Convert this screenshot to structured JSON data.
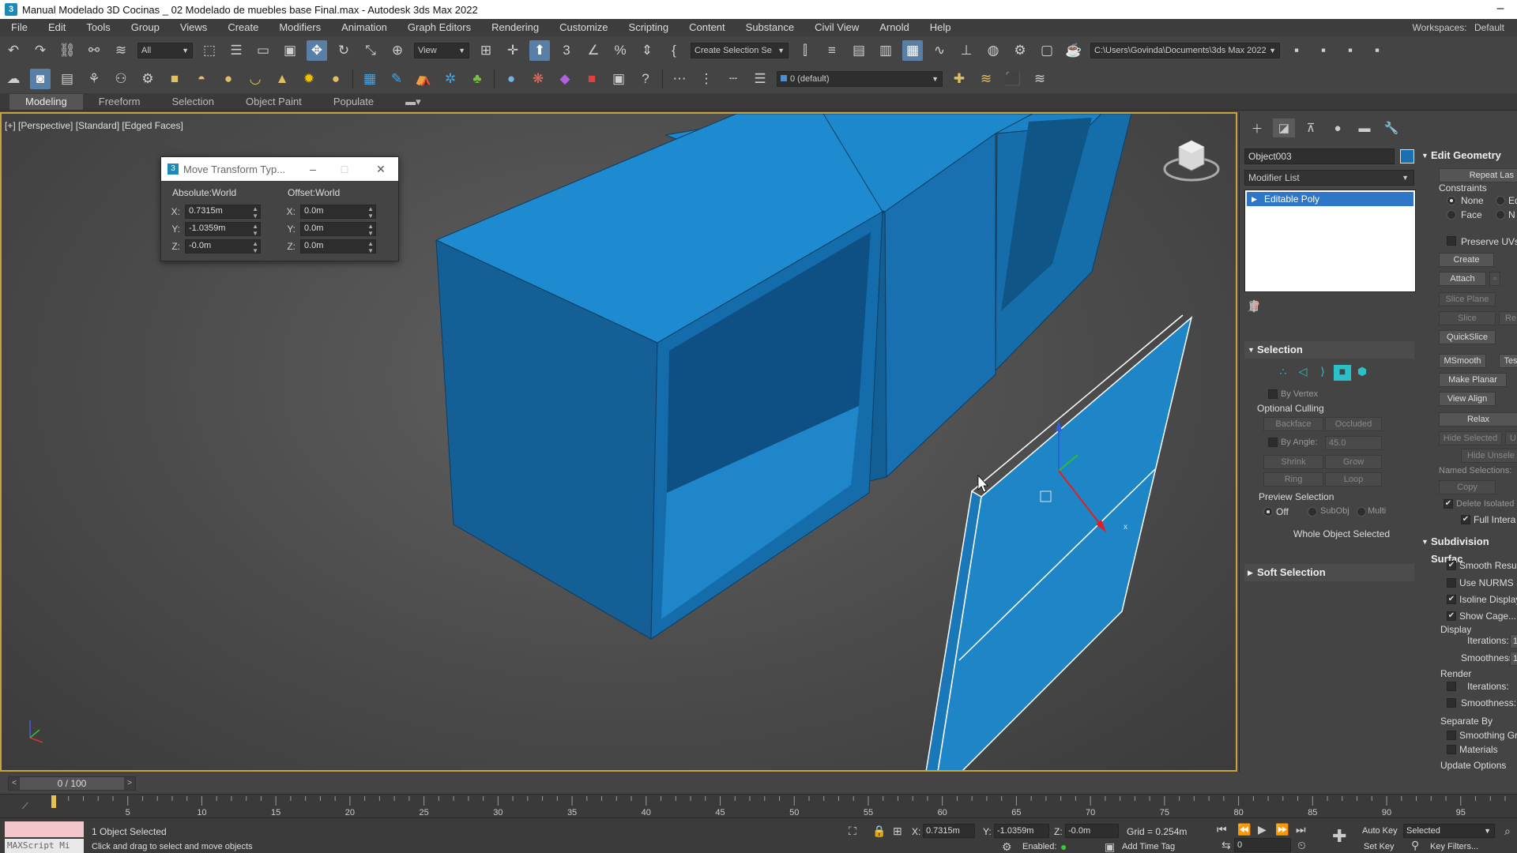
{
  "window": {
    "title": "Manual Modelado 3D Cocinas _ 02 Modelado de muebles base Final.max - Autodesk 3ds Max 2022",
    "minimize": "–"
  },
  "menu": {
    "items": [
      "File",
      "Edit",
      "Tools",
      "Group",
      "Views",
      "Create",
      "Modifiers",
      "Animation",
      "Graph Editors",
      "Rendering",
      "Customize",
      "Scripting",
      "Content",
      "Substance",
      "Civil View",
      "Arnold",
      "Help"
    ],
    "workspace_label": "Workspaces:",
    "workspace_value": "Default"
  },
  "toolbar": {
    "filter_dropdown": "All",
    "ref_coord": "View",
    "selection_set": "Create Selection Se",
    "project_path": "C:\\Users\\Govinda\\Documents\\3ds Max 2022",
    "layer": "0 (default)"
  },
  "ribbon": {
    "tabs": [
      "Modeling",
      "Freeform",
      "Selection",
      "Object Paint",
      "Populate"
    ]
  },
  "viewport": {
    "label": "[+] [Perspective] [Standard] [Edged Faces]",
    "object_color": "#1a6fb0",
    "gizmo_x": "x",
    "gizmo_y": "y",
    "gizmo_z": "z"
  },
  "dialog": {
    "title": "Move Transform Typ...",
    "absolute_label": "Absolute:World",
    "offset_label": "Offset:World",
    "abs_x": "0.7315m",
    "abs_y": "-1.0359m",
    "abs_z": "-0.0m",
    "off_x": "0.0m",
    "off_y": "0.0m",
    "off_z": "0.0m",
    "axis_x": "X:",
    "axis_y": "Y:",
    "axis_z": "Z:"
  },
  "command_panel": {
    "object_name": "Object003",
    "modifier_list": "Modifier List",
    "stack_item": "Editable Poly",
    "selection": {
      "title": "Selection",
      "by_vertex": "By Vertex",
      "optional_culling": "Optional Culling",
      "backface": "Backface",
      "occluded": "Occluded",
      "by_angle": "By Angle:",
      "angle_value": "45.0",
      "shrink": "Shrink",
      "grow": "Grow",
      "ring": "Ring",
      "loop": "Loop",
      "preview_selection": "Preview Selection",
      "off": "Off",
      "subobj": "SubObj",
      "multi": "Multi",
      "status": "Whole Object Selected"
    },
    "soft_selection": "Soft Selection",
    "edit_geometry": {
      "title": "Edit Geometry",
      "repeat_last": "Repeat Las",
      "constraints": "Constraints",
      "none": "None",
      "edge": "Ed",
      "face": "Face",
      "normal": "N",
      "preserve_uvs": "Preserve UVs",
      "create": "Create",
      "attach": "Attach",
      "slice_plane": "Slice Plane",
      "slice": "Slice",
      "reset": "Re",
      "quickslice": "QuickSlice",
      "msmooth": "MSmooth",
      "tessellate": "Tes",
      "make_planar": "Make Planar",
      "view_align": "View Align",
      "relax": "Relax",
      "hide_selected": "Hide Selected",
      "unhide": "U",
      "hide_unselected": "Hide Unsele",
      "named_selections": "Named Selections:",
      "copy": "Copy",
      "delete_isolated": "Delete Isolated",
      "full_interactivity": "Full Intera"
    },
    "subdivision": {
      "title": "Subdivision Surfac",
      "smooth_result": "Smooth Result",
      "use_nurms": "Use NURMS Sub",
      "isoline_display": "Isoline Display",
      "show_cage": "Show Cage.......",
      "display": "Display",
      "iterations": "Iterations:",
      "iterations_val": "1",
      "smoothness": "Smoothness:",
      "smoothness_val": "1",
      "render": "Render",
      "r_iterations": "Iterations:",
      "r_smoothness": "Smoothness:",
      "separate_by": "Separate By",
      "smoothing_groups": "Smoothing Grou",
      "materials": "Materials",
      "update_options": "Update Options"
    }
  },
  "timeline": {
    "frame": "0 / 100",
    "ticks": [
      "5",
      "10",
      "15",
      "20",
      "25",
      "30",
      "35",
      "40",
      "45",
      "50",
      "55",
      "60",
      "65",
      "70",
      "75",
      "80",
      "85",
      "90",
      "95"
    ]
  },
  "status": {
    "maxscript": "MAXScript Mi",
    "selected": "1 Object Selected",
    "prompt": "Click and drag to select and move objects",
    "x_label": "X:",
    "x_val": "0.7315m",
    "y_label": "Y:",
    "y_val": "-1.0359m",
    "z_label": "Z:",
    "z_val": "-0.0m",
    "grid": "Grid = 0.254m",
    "enabled": "Enabled:",
    "add_time_tag": "Add Time Tag",
    "auto_key": "Auto Key",
    "set_key": "Set Key",
    "selected_dropdown": "Selected",
    "key_filters": "Key Filters...",
    "frame_field": "0"
  }
}
